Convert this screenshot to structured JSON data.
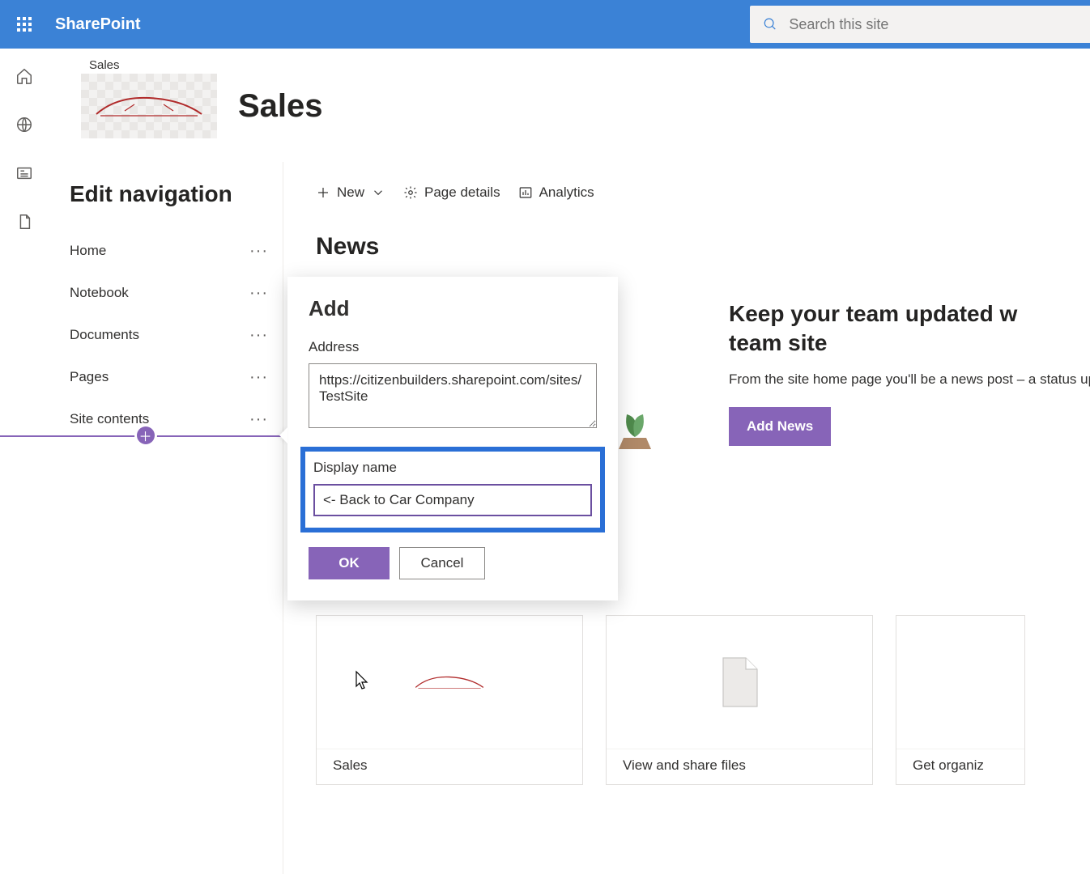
{
  "header": {
    "brand": "SharePoint",
    "search_placeholder": "Search this site"
  },
  "site": {
    "crumb": "Sales",
    "title": "Sales"
  },
  "leftnav": {
    "title": "Edit navigation",
    "items": [
      {
        "label": "Home"
      },
      {
        "label": "Notebook"
      },
      {
        "label": "Documents"
      },
      {
        "label": "Pages"
      },
      {
        "label": "Site contents"
      }
    ]
  },
  "commandbar": {
    "new_label": "New",
    "page_details": "Page details",
    "analytics": "Analytics"
  },
  "news": {
    "heading": "News",
    "title": "Keep your team updated w",
    "subtitle": "team site",
    "body": "From the site home page you'll be a news post – a status update, trip",
    "add_button": "Add News"
  },
  "callout": {
    "title": "Add",
    "address_label": "Address",
    "address_value": "https://citizenbuilders.sharepoint.com/sites/TestSite",
    "display_label": "Display name",
    "display_value": "<- Back to Car Company",
    "ok": "OK",
    "cancel": "Cancel"
  },
  "cards": [
    {
      "title": "Sales"
    },
    {
      "title": "View and share files"
    },
    {
      "title": "Get organiz"
    }
  ]
}
